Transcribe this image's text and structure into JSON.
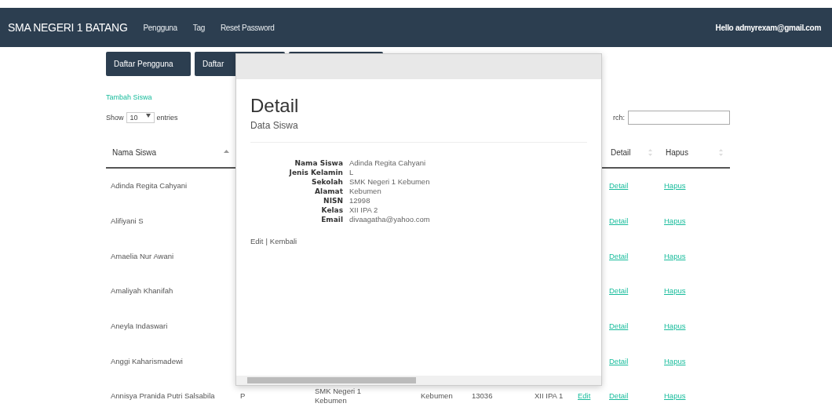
{
  "navbar": {
    "brand": "SMA NEGERI 1 BATANG",
    "links": [
      "Pengguna",
      "Tag",
      "Reset Password"
    ],
    "user": "Hello admyrexam@gmail.com"
  },
  "tabs": [
    {
      "label": "Daftar Pengguna"
    },
    {
      "label": "Daftar"
    }
  ],
  "add_link": "Tambah Siswa",
  "length": {
    "before": "Show",
    "value": "10",
    "after": "entries"
  },
  "search": {
    "label": "rch:"
  },
  "table": {
    "columns": [
      "Nama Siswa",
      "Detail",
      "Hapus"
    ],
    "rows": [
      {
        "name": "Adinda Regita Cahyani",
        "detail": "Detail",
        "delete": "Hapus"
      },
      {
        "name": "Alifiyani S",
        "detail": "Detail",
        "delete": "Hapus"
      },
      {
        "name": "Amaelia Nur Awani",
        "detail": "Detail",
        "delete": "Hapus"
      },
      {
        "name": "Amaliyah Khanifah",
        "detail": "Detail",
        "delete": "Hapus"
      },
      {
        "name": "Aneyla Indaswari",
        "detail": "Detail",
        "delete": "Hapus"
      },
      {
        "name": "Anggi Kaharismadewi",
        "detail": "Detail",
        "delete": "Hapus"
      },
      {
        "name": "Annisya Pranida Putri Salsabila",
        "gender": "P",
        "school": "SMK Negeri 1 Kebumen",
        "address": "Kebumen",
        "nisn": "13036",
        "class": "XII IPA 1",
        "edit": "Edit",
        "detail": "Detail",
        "delete": "Hapus"
      }
    ]
  },
  "modal": {
    "title": "Detail",
    "subtitle": "Data Siswa",
    "fields": [
      {
        "label": "Nama Siswa",
        "value": "Adinda Regita Cahyani"
      },
      {
        "label": "Jenis Kelamin",
        "value": "L"
      },
      {
        "label": "Sekolah",
        "value": "SMK Negeri 1 Kebumen"
      },
      {
        "label": "Alamat",
        "value": "Kebumen"
      },
      {
        "label": "NISN",
        "value": "12998"
      },
      {
        "label": "Kelas",
        "value": "XII IPA 2"
      },
      {
        "label": "Email",
        "value": "divaagatha@yahoo.com"
      }
    ],
    "actions": [
      "Edit",
      "Kembali"
    ],
    "separator": "|"
  }
}
